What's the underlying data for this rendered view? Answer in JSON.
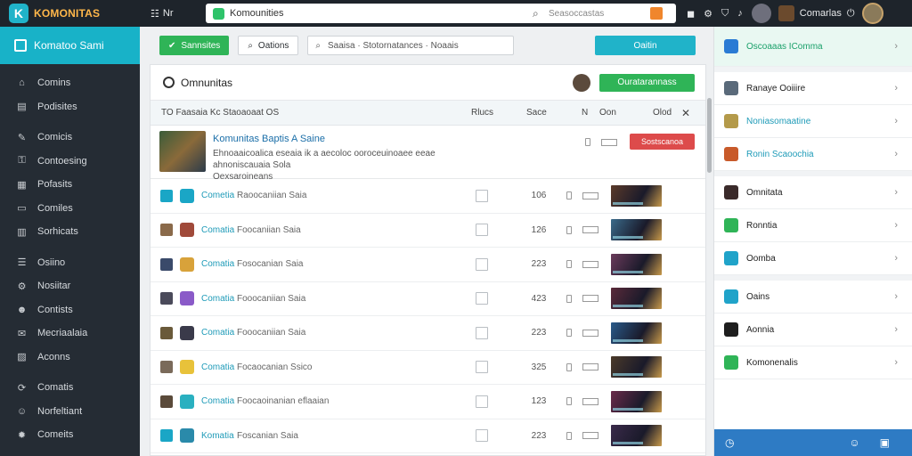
{
  "app": {
    "brand": "KOMONITAS",
    "logo_letter": "K"
  },
  "topbar": {
    "menu_label": "Nr",
    "tab_text": "Komounities",
    "search_placeholder": "Seasoccastas",
    "user_name": "Comarlas",
    "icons": [
      "grid-icon",
      "tab-icon",
      "search-icon",
      "orange-tag-icon",
      "camera-icon",
      "settings-icon",
      "shield-icon",
      "bell-icon"
    ]
  },
  "sidebar": {
    "header": "Komatoo Sami",
    "groups": [
      [
        {
          "label": "Comins",
          "icon": "home-icon"
        },
        {
          "label": "Podisites",
          "icon": "doc-icon"
        }
      ],
      [
        {
          "label": "Comicis",
          "icon": "pin-icon"
        },
        {
          "label": "Contoesing",
          "icon": "lock-icon"
        },
        {
          "label": "Pofasits",
          "icon": "grid-icon"
        },
        {
          "label": "Comiles",
          "icon": "folder-icon"
        },
        {
          "label": "Sorhicats",
          "icon": "calendar-icon"
        }
      ],
      [
        {
          "label": "Osiino",
          "icon": "list-icon"
        },
        {
          "label": "Nosiitar",
          "icon": "settings-icon"
        },
        {
          "label": "Contists",
          "icon": "user-icon"
        },
        {
          "label": "Mecriaalaia",
          "icon": "mail-icon"
        },
        {
          "label": "Aconns",
          "icon": "chart-icon"
        }
      ],
      [
        {
          "label": "Comatis",
          "icon": "refresh-icon"
        },
        {
          "label": "Norfeltiant",
          "icon": "people-icon"
        },
        {
          "label": "Comeits",
          "icon": "fire-icon"
        }
      ]
    ]
  },
  "toolbar": {
    "green_button": "Sannsites",
    "outline_button": "Oations",
    "search_text": "Saaisa · Stotornatances · Noaais",
    "teal_button": "Oaitin"
  },
  "card": {
    "title": "Omnunitas",
    "header_button": "Ouratarannass"
  },
  "table": {
    "header_left": "TO  Faasaia  Kc  Staoaoaat  OS",
    "columns": [
      "Rlucs",
      "Sace",
      "N",
      "Oon",
      "Olod"
    ],
    "featured": {
      "title": "Komunitas Baptis A Saine",
      "desc": "Ehnoaaicoalica eseaia ik a aecoloc ooroceuinoaee eeae ahnoniscauaia Sola",
      "desc2": "Oexsaroineans",
      "button": "Sostscanoa"
    },
    "rows": [
      {
        "name": "Cometia",
        "sub": "Raoocaniian Saia",
        "num": "106",
        "colors": [
          "#1aa6c6",
          "#1aa6c6"
        ],
        "thumb": "#5a3a2a"
      },
      {
        "name": "Comatia",
        "sub": "Foocaniian Saia",
        "num": "126",
        "colors": [
          "#8a6a4a",
          "#a04a3a"
        ],
        "thumb": "#3a6a8a"
      },
      {
        "name": "Comatia",
        "sub": "Fosocanian Saia",
        "num": "223",
        "colors": [
          "#3a4a6a",
          "#d8a23a"
        ],
        "thumb": "#6a3a5a"
      },
      {
        "name": "Comatia",
        "sub": "Fooocaniian Saia",
        "num": "423",
        "colors": [
          "#4a4a5a",
          "#8a5ac8"
        ],
        "thumb": "#5a2a3a"
      },
      {
        "name": "Comatia",
        "sub": "Fooocaniian Saia",
        "num": "223",
        "colors": [
          "#6a5a3a",
          "#3a3a4a"
        ],
        "thumb": "#2a5a8a"
      },
      {
        "name": "Comatia",
        "sub": "Focaocanian Ssico",
        "num": "325",
        "colors": [
          "#7a6a5a",
          "#e8c23a"
        ],
        "thumb": "#4a3a2a"
      },
      {
        "name": "Comatia",
        "sub": "Foocaoinanian eflaaian",
        "num": "123",
        "colors": [
          "#5a4a3a",
          "#2ab0c0"
        ],
        "thumb": "#6a2a4a"
      },
      {
        "name": "Komatia",
        "sub": "Foscanian Saia",
        "num": "223",
        "colors": [
          "#1aa6c6",
          "#2a8aaa"
        ],
        "thumb": "#3a2a4a"
      }
    ]
  },
  "rightpanel": {
    "items": [
      {
        "label": "Oscoaaas IComma",
        "icon_color": "#2a7bd4",
        "style": "active"
      },
      {
        "label": "Ranaye Ooiiire",
        "icon_color": "#5a6a7a",
        "style": "normal"
      },
      {
        "label": "Noniasomaatine",
        "icon_color": "#b49a4a",
        "style": "teal"
      },
      {
        "label": "Ronin Scaoochia",
        "icon_color": "#c85a2a",
        "style": "teal"
      },
      {
        "label": "Omnitata",
        "icon_color": "#3a2a2a",
        "style": "normal"
      },
      {
        "label": "Ronntia",
        "icon_color": "#2fb457",
        "style": "normal"
      },
      {
        "label": "Oomba",
        "icon_color": "#20a3c9",
        "style": "normal"
      },
      {
        "label": "Oains",
        "icon_color": "#20a3c9",
        "style": "normal"
      },
      {
        "label": "Aonnia",
        "icon_color": "#1e1e1e",
        "style": "normal"
      },
      {
        "label": "Komonenalis",
        "icon_color": "#2fb457",
        "style": "normal"
      }
    ]
  }
}
